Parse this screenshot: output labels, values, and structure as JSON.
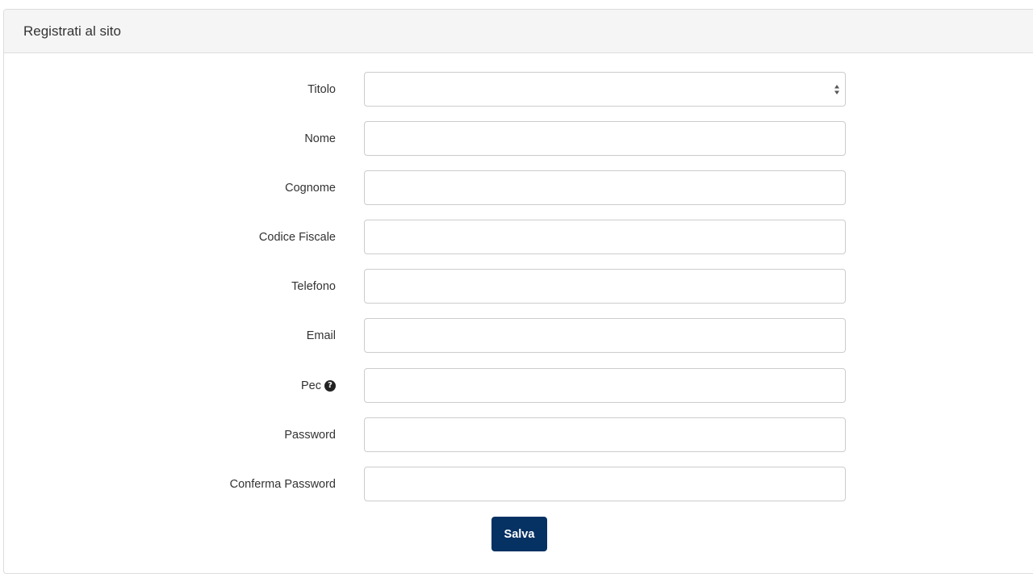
{
  "panel": {
    "title": "Registrati al sito"
  },
  "form": {
    "fields": [
      {
        "label": "Titolo",
        "type": "select",
        "value": ""
      },
      {
        "label": "Nome",
        "type": "text",
        "value": ""
      },
      {
        "label": "Cognome",
        "type": "text",
        "value": ""
      },
      {
        "label": "Codice Fiscale",
        "type": "text",
        "value": ""
      },
      {
        "label": "Telefono",
        "type": "text",
        "value": ""
      },
      {
        "label": "Email",
        "type": "text",
        "value": ""
      },
      {
        "label": "Pec",
        "type": "text",
        "value": "",
        "help_icon": "question-circle-icon"
      },
      {
        "label": "Password",
        "type": "password",
        "value": ""
      },
      {
        "label": "Conferma Password",
        "type": "password",
        "value": ""
      }
    ],
    "submit_label": "Salva"
  },
  "colors": {
    "button_bg": "#063163",
    "heading_bg": "#f5f5f5",
    "border": "#cccccc"
  }
}
